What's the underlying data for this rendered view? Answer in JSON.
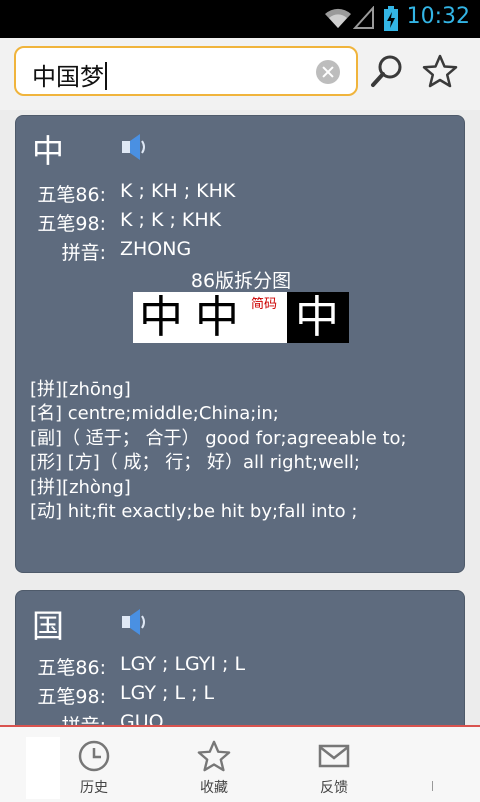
{
  "status_bar": {
    "time": "10:32",
    "icons": [
      "wifi-icon",
      "signal-icon",
      "battery-charging-icon"
    ]
  },
  "search": {
    "query": "中国梦",
    "icons": [
      "clear-icon",
      "search-icon",
      "star-outline-icon"
    ]
  },
  "results": [
    {
      "character": "中",
      "fields": [
        {
          "label": "五笔86:",
          "value": "K ; KH ; KHK"
        },
        {
          "label": "五笔98:",
          "value": "K ; K ; KHK"
        },
        {
          "label": "拼音:",
          "value": "ZHONG"
        }
      ],
      "diagram_title": "86版拆分图",
      "diagram_chars": [
        "中",
        "中",
        "中"
      ],
      "diagram_short_label": "简码",
      "definitions": [
        "[拼][zhōng]",
        "[名] centre;middle;China;in;",
        "[副]（ 适于； 合于） good for;agreeable to;",
        "[形] [方]（ 成； 行； 好）all right;well;",
        "[拼][zhòng]",
        "[动] hit;fit exactly;be hit by;fall into ;"
      ]
    },
    {
      "character": "国",
      "fields": [
        {
          "label": "五笔86:",
          "value": "LGY ; LGYI ; L"
        },
        {
          "label": "五笔98:",
          "value": "LGY ; L ; L"
        },
        {
          "label": "拼音:",
          "value": "GUO"
        }
      ]
    }
  ],
  "bottom_nav": [
    {
      "label": "历史",
      "icon": "clock-icon"
    },
    {
      "label": "收藏",
      "icon": "star-outline-icon"
    },
    {
      "label": "反馈",
      "icon": "envelope-icon"
    }
  ],
  "colors": {
    "accent": "#33b5e5",
    "search_border": "#f0b43c",
    "card_bg": "#5e6b7e",
    "nav_border": "#d9534f",
    "short_code_red": "#cc0000"
  }
}
